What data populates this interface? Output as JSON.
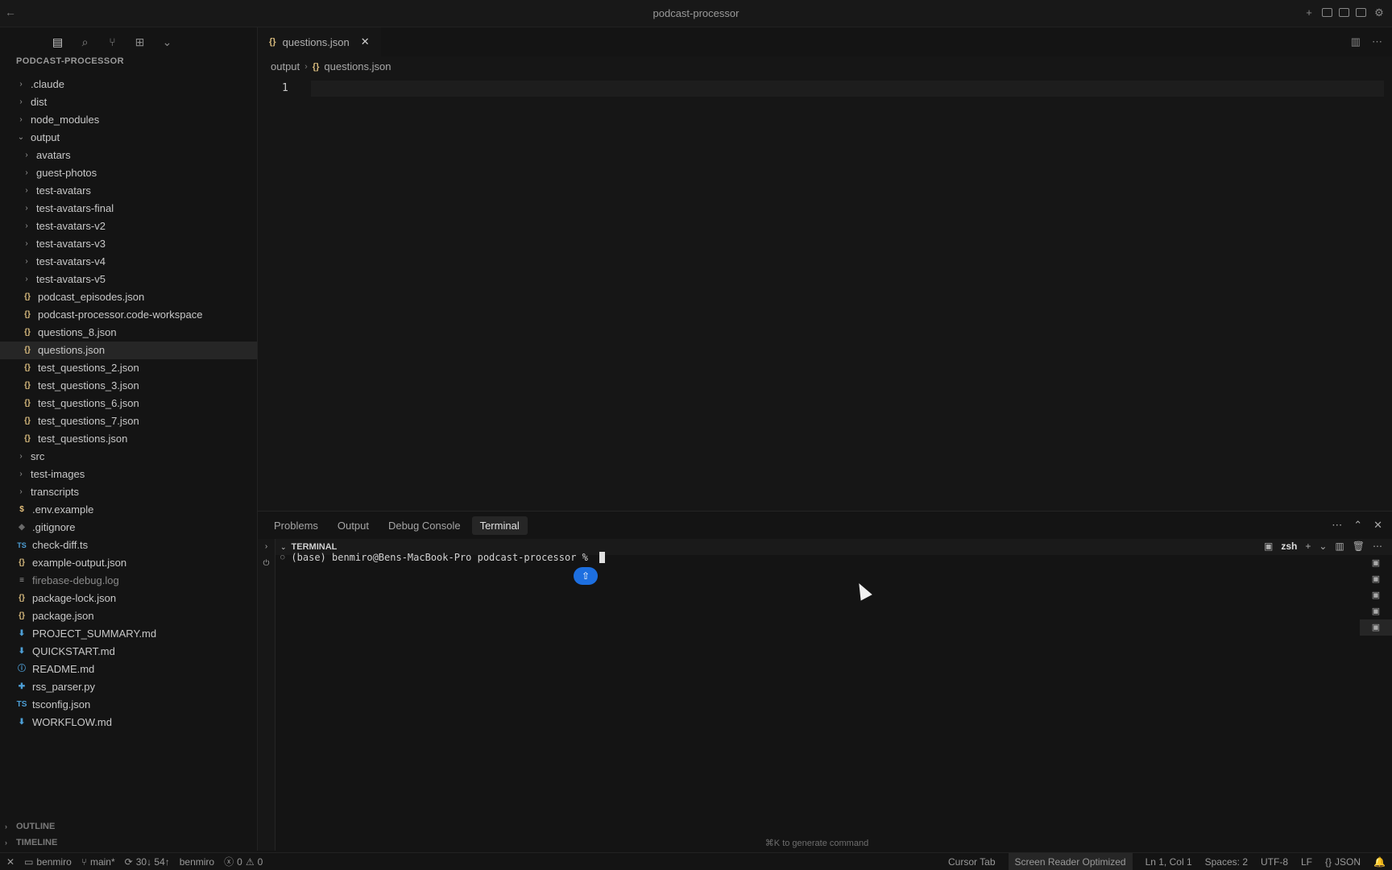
{
  "window": {
    "title": "podcast-processor"
  },
  "explorer": {
    "title": "PODCAST-PROCESSOR",
    "items": [
      {
        "label": ".claude",
        "type": "folder",
        "depth": 0,
        "open": false
      },
      {
        "label": "dist",
        "type": "folder",
        "depth": 0,
        "open": false
      },
      {
        "label": "node_modules",
        "type": "folder",
        "depth": 0,
        "open": false
      },
      {
        "label": "output",
        "type": "folder",
        "depth": 0,
        "open": true
      },
      {
        "label": "avatars",
        "type": "folder",
        "depth": 1,
        "open": false
      },
      {
        "label": "guest-photos",
        "type": "folder",
        "depth": 1,
        "open": false
      },
      {
        "label": "test-avatars",
        "type": "folder",
        "depth": 1,
        "open": false
      },
      {
        "label": "test-avatars-final",
        "type": "folder",
        "depth": 1,
        "open": false
      },
      {
        "label": "test-avatars-v2",
        "type": "folder",
        "depth": 1,
        "open": false
      },
      {
        "label": "test-avatars-v3",
        "type": "folder",
        "depth": 1,
        "open": false
      },
      {
        "label": "test-avatars-v4",
        "type": "folder",
        "depth": 1,
        "open": false
      },
      {
        "label": "test-avatars-v5",
        "type": "folder",
        "depth": 1,
        "open": false
      },
      {
        "label": "podcast_episodes.json",
        "type": "json",
        "depth": 1
      },
      {
        "label": "podcast-processor.code-workspace",
        "type": "json",
        "depth": 1
      },
      {
        "label": "questions_8.json",
        "type": "json",
        "depth": 1
      },
      {
        "label": "questions.json",
        "type": "json",
        "depth": 1,
        "selected": true
      },
      {
        "label": "test_questions_2.json",
        "type": "json",
        "depth": 1
      },
      {
        "label": "test_questions_3.json",
        "type": "json",
        "depth": 1
      },
      {
        "label": "test_questions_6.json",
        "type": "json",
        "depth": 1
      },
      {
        "label": "test_questions_7.json",
        "type": "json",
        "depth": 1
      },
      {
        "label": "test_questions.json",
        "type": "json",
        "depth": 1
      },
      {
        "label": "src",
        "type": "folder",
        "depth": 0,
        "open": false
      },
      {
        "label": "test-images",
        "type": "folder",
        "depth": 0,
        "open": false
      },
      {
        "label": "transcripts",
        "type": "folder",
        "depth": 0,
        "open": false
      },
      {
        "label": ".env.example",
        "type": "env",
        "depth": 0
      },
      {
        "label": ".gitignore",
        "type": "git",
        "depth": 0
      },
      {
        "label": "check-diff.ts",
        "type": "ts",
        "depth": 0
      },
      {
        "label": "example-output.json",
        "type": "json",
        "depth": 0
      },
      {
        "label": "firebase-debug.log",
        "type": "log",
        "depth": 0,
        "dim": true
      },
      {
        "label": "package-lock.json",
        "type": "json",
        "depth": 0
      },
      {
        "label": "package.json",
        "type": "json",
        "depth": 0
      },
      {
        "label": "PROJECT_SUMMARY.md",
        "type": "md",
        "depth": 0
      },
      {
        "label": "QUICKSTART.md",
        "type": "md",
        "depth": 0
      },
      {
        "label": "README.md",
        "type": "info",
        "depth": 0
      },
      {
        "label": "rss_parser.py",
        "type": "py",
        "depth": 0
      },
      {
        "label": "tsconfig.json",
        "type": "tsconfig",
        "depth": 0
      },
      {
        "label": "WORKFLOW.md",
        "type": "md",
        "depth": 0
      }
    ],
    "outline_label": "OUTLINE",
    "timeline_label": "TIMELINE"
  },
  "editor": {
    "tab_label": "questions.json",
    "breadcrumb_folder": "output",
    "breadcrumb_file": "questions.json",
    "line_number": "1"
  },
  "panel": {
    "tabs": [
      "Problems",
      "Output",
      "Debug Console",
      "Terminal"
    ],
    "active_tab": "Terminal",
    "section_label": "TERMINAL",
    "shell_label": "zsh",
    "prompt": "(base) benmiro@Bens-MacBook-Pro podcast-processor %",
    "hint": "⌘K to generate command"
  },
  "status": {
    "remote": "benmiro",
    "branch": "main*",
    "sync": "30↓ 54↑",
    "account": "benmiro",
    "errors": "0",
    "warnings": "0",
    "cursor_tab": "Cursor Tab",
    "screen_reader": "Screen Reader Optimized",
    "position": "Ln 1, Col 1",
    "spaces": "Spaces: 2",
    "encoding": "UTF-8",
    "eol": "LF",
    "language": "JSON"
  },
  "colors": {
    "accent": "#1d6fe0",
    "json_icon": "#d7ba7d"
  }
}
